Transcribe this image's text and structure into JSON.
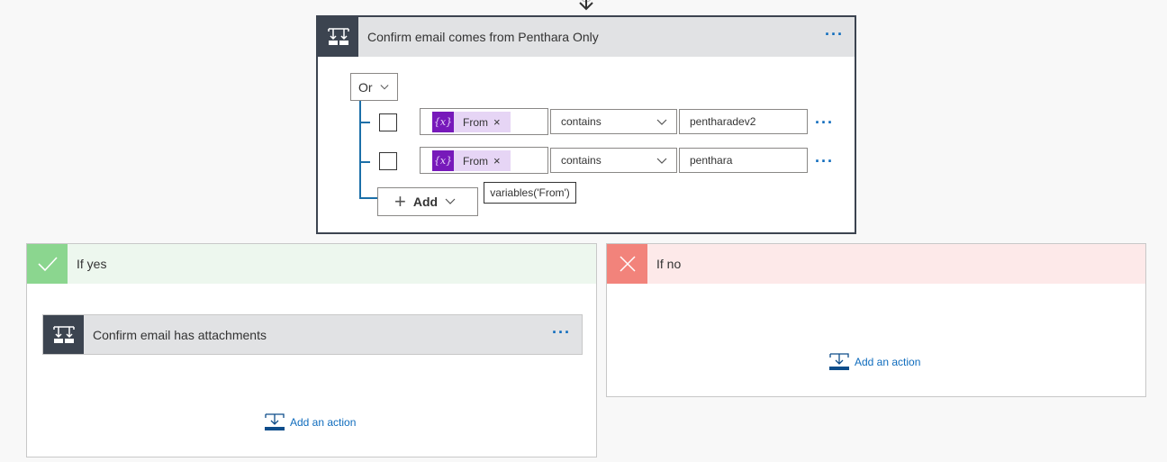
{
  "condition": {
    "title": "Confirm email comes from Penthara Only",
    "more_label": "···",
    "group_operator": "Or",
    "rows": [
      {
        "token_icon": "{x}",
        "token_label": "From",
        "token_remove": "×",
        "operator": "contains",
        "value": "pentharadev2",
        "more_label": "···"
      },
      {
        "token_icon": "{x}",
        "token_label": "From",
        "token_remove": "×",
        "operator": "contains",
        "value": "penthara",
        "more_label": "···"
      }
    ],
    "add_button": {
      "plus": "+",
      "label": "Add"
    },
    "tooltip": "variables('From')"
  },
  "branches": {
    "yes": {
      "title": "If yes",
      "icon": "check-icon",
      "color": "#8bd68f",
      "action": {
        "title": "Confirm email has attachments",
        "more_label": "···"
      },
      "add_action_label": "Add an action"
    },
    "no": {
      "title": "If no",
      "icon": "close-icon",
      "color": "#f2837b",
      "add_action_label": "Add an action"
    }
  },
  "colors": {
    "accent": "#0f6cbd",
    "card_icon_bg": "#3c4450",
    "variable_token": "#7719ba",
    "tree_line": "#1b6fa8"
  }
}
